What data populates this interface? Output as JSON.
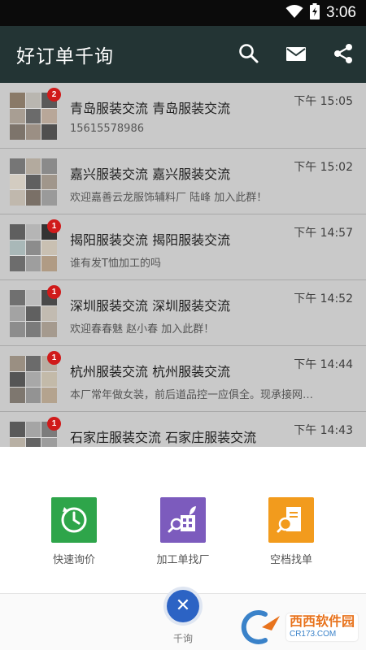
{
  "status_bar": {
    "time": "3:06"
  },
  "app_bar": {
    "title": "好订单千询"
  },
  "colors": {
    "app_bar": "#233434",
    "badge": "#d01a1a",
    "green_tile": "#2ea54a",
    "purple_tile": "#7c5bbd",
    "orange_tile": "#f29b1d",
    "fab": "#2c63c4"
  },
  "chats": [
    {
      "title": "青岛服装交流  青岛服装交流",
      "subtitle": "15615578986",
      "time": "下午 15:05",
      "badge": "2"
    },
    {
      "title": "嘉兴服装交流  嘉兴服装交流",
      "subtitle": "欢迎嘉善云龙服饰辅料厂 陆峰 加入此群！",
      "time": "下午 15:02",
      "badge": ""
    },
    {
      "title": "揭阳服装交流  揭阳服装交流",
      "subtitle": "谁有发T恤加工的吗",
      "time": "下午 14:57",
      "badge": "1"
    },
    {
      "title": "深圳服装交流  深圳服装交流",
      "subtitle": "欢迎春春魅 赵小春 加入此群！",
      "time": "下午 14:52",
      "badge": "1"
    },
    {
      "title": "杭州服装交流  杭州服装交流",
      "subtitle": "本厂常年做女装，前后道品控一应俱全。现承接网…",
      "time": "下午 14:44",
      "badge": "1"
    },
    {
      "title": "石家庄服装交流  石家庄服装交流",
      "subtitle": "",
      "time": "下午 14:43",
      "badge": "1"
    }
  ],
  "actions": [
    {
      "label": "快速询价",
      "icon": "clock-refresh-icon"
    },
    {
      "label": "加工单找厂",
      "icon": "factory-search-icon"
    },
    {
      "label": "空档找单",
      "icon": "document-search-icon"
    }
  ],
  "bottom_nav": {
    "fab_symbol": "✕",
    "label": "千询"
  },
  "watermark": {
    "main": "西西软件园",
    "sub": "CR173.COM"
  }
}
